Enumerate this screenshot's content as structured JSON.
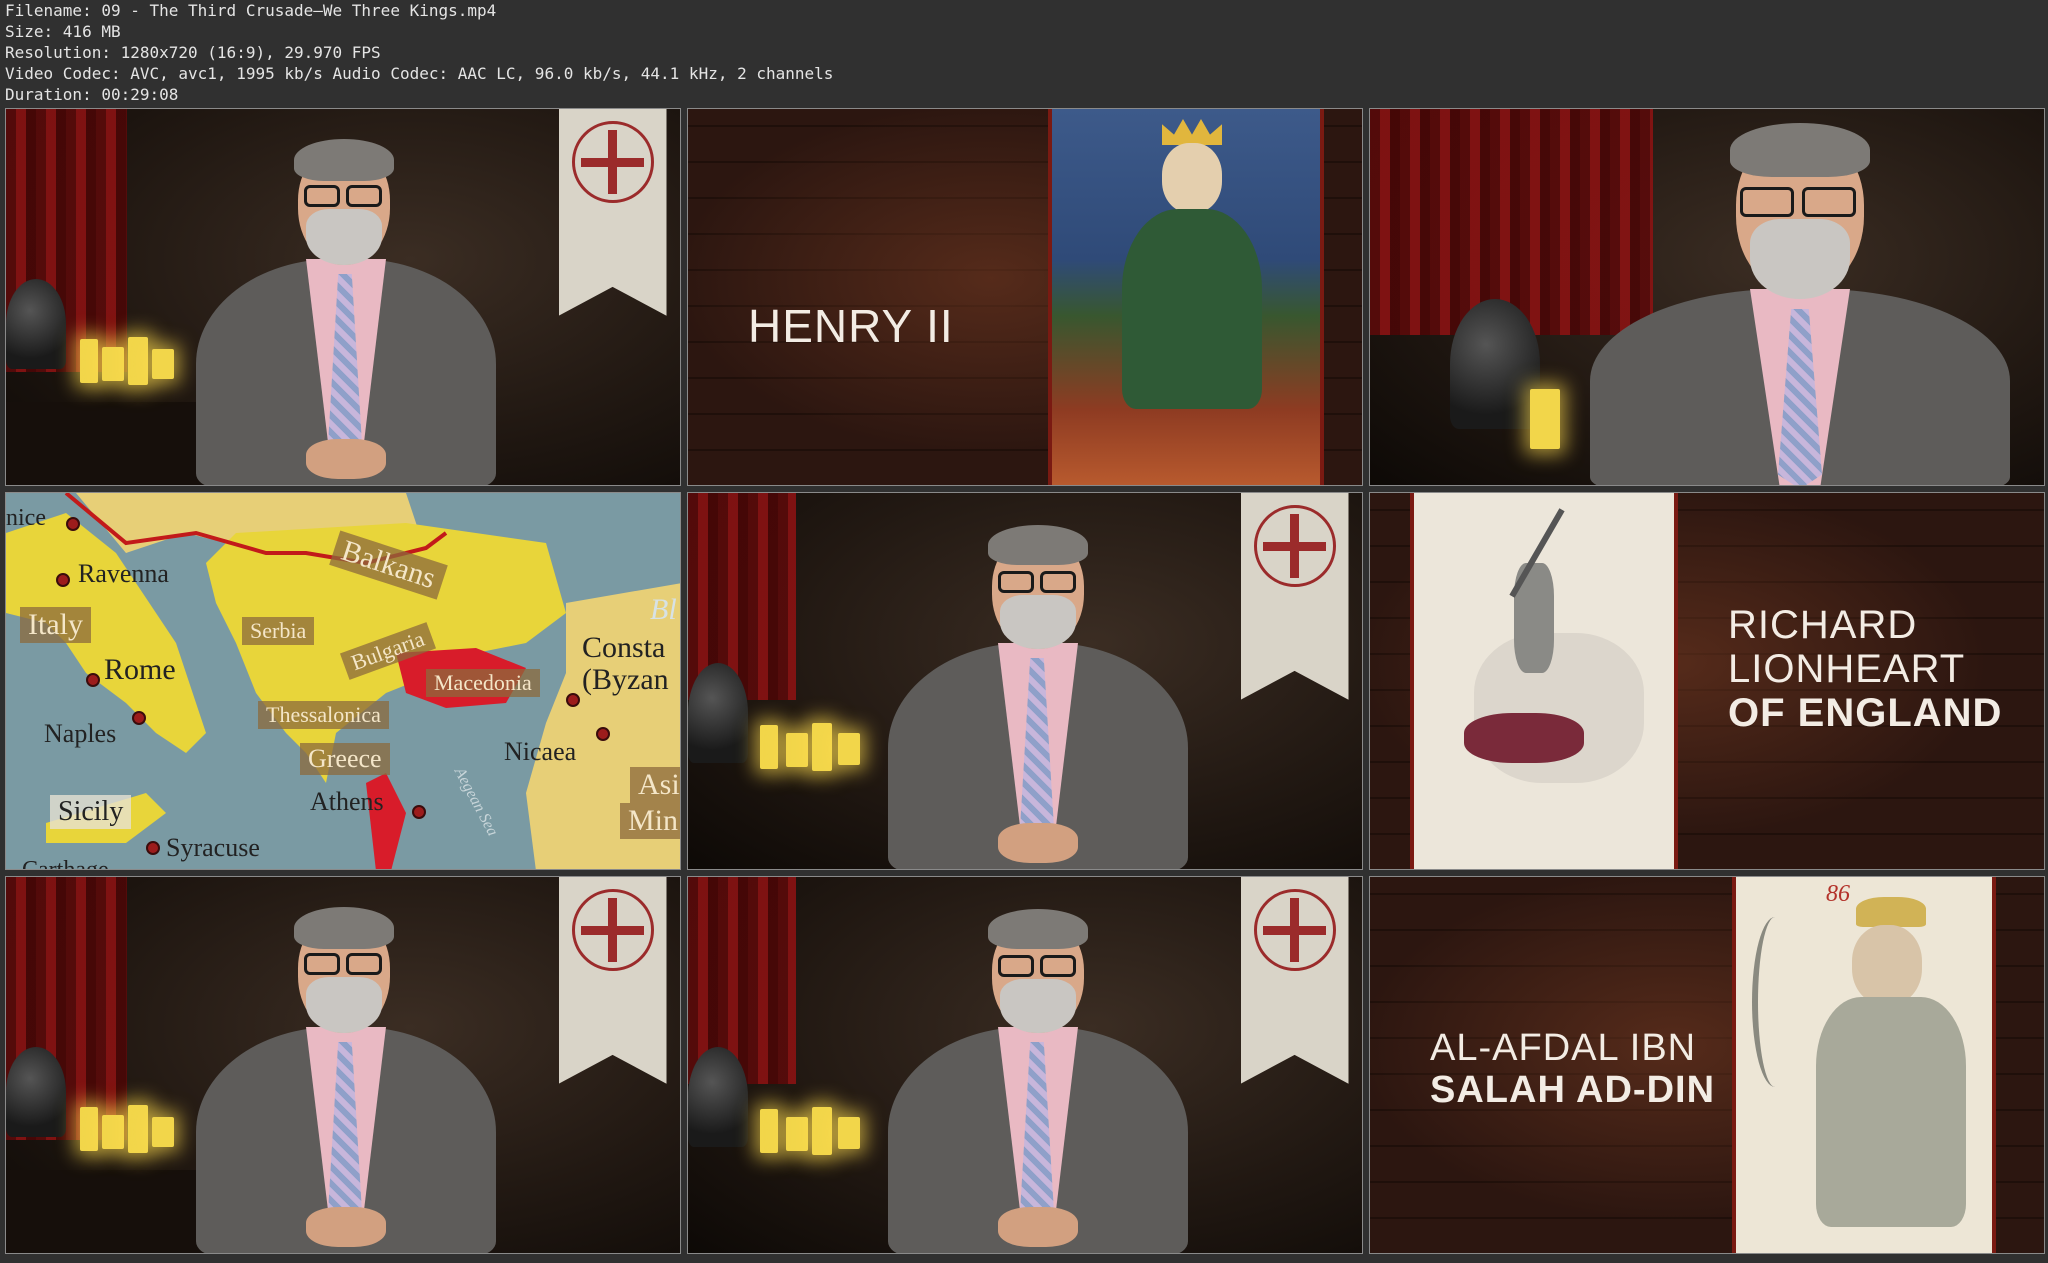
{
  "header": {
    "filename": "Filename: 09 - The Third Crusade—We Three Kings.mp4",
    "size": "Size: 416 MB",
    "resolution": "Resolution: 1280x720 (16:9), 29.970 FPS",
    "codec": "Video Codec: AVC, avc1, 1995 kb/s Audio Codec: AAC LC, 96.0 kb/s, 44.1 kHz, 2 channels",
    "duration": "Duration: 00:29:08"
  },
  "thumbnails": {
    "henry": {
      "line1": "HENRY II"
    },
    "richard": {
      "line1": "RICHARD",
      "line2": "LIONHEART",
      "line3": "OF ENGLAND"
    },
    "afdal": {
      "line1": "AL-AFDAL IBN",
      "line2": "SALAH AD-DIN"
    },
    "afdal_art_mark": "86",
    "map": {
      "labels": [
        "nice",
        "Ravenna",
        "Italy",
        "Rome",
        "Naples",
        "Sicily",
        "Syracuse",
        "Carthage",
        "Balkans",
        "Serbia",
        "Bulgaria",
        "Macedonia",
        "Thessalonica",
        "Greece",
        "Athens",
        "Nicaea",
        "Consta",
        "(Byzan",
        "Bl",
        "Asi",
        "Min",
        "Aegean Sea"
      ]
    }
  },
  "colors": {
    "background": "#303030",
    "brick": "#2a140e",
    "accent_red": "#7a1a12",
    "map_land": "#e7cf77",
    "map_yellow": "#e8d53a",
    "map_red": "#d81c2a",
    "map_sea": "#7a9aa3"
  }
}
